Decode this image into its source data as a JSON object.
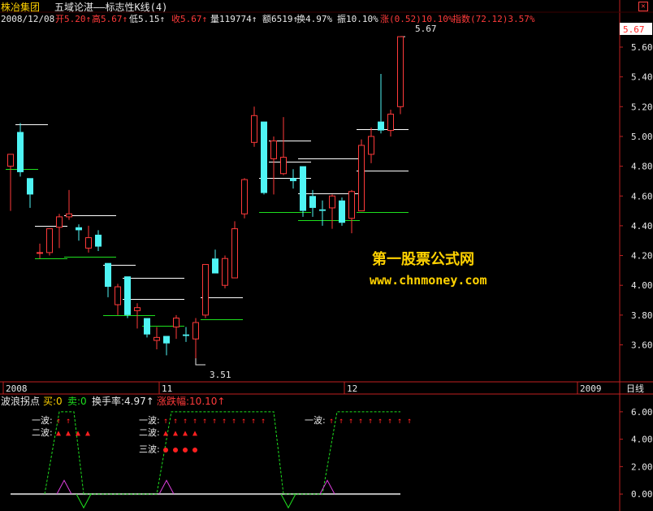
{
  "header": {
    "stock_name": "株冶集团",
    "indicator_title": "五域论湛——标志性K线(4)",
    "date": "2008/12/08",
    "open": "开5.20↑",
    "high": "高5.67↑",
    "low": "低5.15↑",
    "close": "收5.67↑",
    "volume": "量119774↑",
    "amount": "额6519↑",
    "turnover": "换4.97%",
    "amplitude": "振10.10%",
    "change": "涨(0.52)10.10%",
    "index": "指数(72.12)3.57%",
    "close_icon": "close-icon"
  },
  "price_panel": {
    "y_ticks": [
      "5.60",
      "5.40",
      "5.20",
      "5.00",
      "4.80",
      "4.60",
      "4.40",
      "4.20",
      "4.00",
      "3.80",
      "3.60"
    ],
    "current_price_box": "5.67",
    "high_label": "5.67",
    "low_label": "3.51"
  },
  "time_axis": {
    "labels": [
      "2008",
      "11",
      "12",
      "2009"
    ],
    "period_label": "日线"
  },
  "watermark": {
    "title": "第一股票公式网",
    "url": "www.chnmoney.com"
  },
  "indicator_panel": {
    "name": "波浪拐点",
    "buy": "买:0",
    "sell": "卖:0",
    "turnover": "换手率:4.97↑",
    "change": "涨跌幅:10.10↑",
    "y_ticks": [
      "6.00",
      "4.00",
      "2.00",
      "0.00"
    ],
    "wave_labels": [
      "一波:",
      "二波:",
      "一波:",
      "二波:",
      "三波:",
      "一波:"
    ]
  },
  "chart_data": {
    "type": "candlestick",
    "ylim": [
      3.45,
      5.72
    ],
    "colors": {
      "up": "#ff3a3a",
      "down": "#4ff4f4",
      "background": "#000000",
      "axis": "#c02020"
    },
    "candles": [
      {
        "o": 4.8,
        "h": 4.88,
        "l": 4.5,
        "c": 4.88
      },
      {
        "o": 5.03,
        "h": 5.09,
        "l": 4.73,
        "c": 4.76
      },
      {
        "o": 4.72,
        "h": 4.72,
        "l": 4.52,
        "c": 4.61
      },
      {
        "o": 4.22,
        "h": 4.28,
        "l": 4.18,
        "c": 4.22
      },
      {
        "o": 4.22,
        "h": 4.38,
        "l": 4.2,
        "c": 4.38
      },
      {
        "o": 4.39,
        "h": 4.48,
        "l": 4.25,
        "c": 4.46
      },
      {
        "o": 4.46,
        "h": 4.64,
        "l": 4.44,
        "c": 4.48
      },
      {
        "o": 4.39,
        "h": 4.41,
        "l": 4.3,
        "c": 4.37
      },
      {
        "o": 4.25,
        "h": 4.4,
        "l": 4.22,
        "c": 4.32
      },
      {
        "o": 4.34,
        "h": 4.37,
        "l": 4.23,
        "c": 4.26
      },
      {
        "o": 4.15,
        "h": 4.15,
        "l": 3.92,
        "c": 3.99
      },
      {
        "o": 3.87,
        "h": 4.01,
        "l": 3.8,
        "c": 3.99
      },
      {
        "o": 4.06,
        "h": 4.06,
        "l": 3.78,
        "c": 3.8
      },
      {
        "o": 3.83,
        "h": 3.88,
        "l": 3.71,
        "c": 3.85
      },
      {
        "o": 3.78,
        "h": 3.78,
        "l": 3.65,
        "c": 3.67
      },
      {
        "o": 3.63,
        "h": 3.72,
        "l": 3.57,
        "c": 3.65
      },
      {
        "o": 3.66,
        "h": 3.66,
        "l": 3.53,
        "c": 3.61
      },
      {
        "o": 3.72,
        "h": 3.8,
        "l": 3.64,
        "c": 3.78
      },
      {
        "o": 3.67,
        "h": 3.72,
        "l": 3.62,
        "c": 3.66
      },
      {
        "o": 3.64,
        "h": 3.78,
        "l": 3.51,
        "c": 3.75
      },
      {
        "o": 3.8,
        "h": 4.12,
        "l": 3.78,
        "c": 4.14
      },
      {
        "o": 4.18,
        "h": 4.24,
        "l": 4.09,
        "c": 4.08
      },
      {
        "o": 4.0,
        "h": 4.2,
        "l": 3.98,
        "c": 4.18
      },
      {
        "o": 4.05,
        "h": 4.43,
        "l": 4.05,
        "c": 4.38
      },
      {
        "o": 4.48,
        "h": 4.72,
        "l": 4.45,
        "c": 4.71
      },
      {
        "o": 4.96,
        "h": 5.2,
        "l": 4.93,
        "c": 5.14
      },
      {
        "o": 5.1,
        "h": 5.1,
        "l": 4.61,
        "c": 4.62
      },
      {
        "o": 4.85,
        "h": 5.0,
        "l": 4.61,
        "c": 4.97
      },
      {
        "o": 4.75,
        "h": 5.13,
        "l": 4.74,
        "c": 4.86
      },
      {
        "o": 4.72,
        "h": 4.78,
        "l": 4.65,
        "c": 4.7
      },
      {
        "o": 4.8,
        "h": 4.8,
        "l": 4.46,
        "c": 4.5
      },
      {
        "o": 4.6,
        "h": 4.64,
        "l": 4.46,
        "c": 4.52
      },
      {
        "o": 4.51,
        "h": 4.57,
        "l": 4.4,
        "c": 4.5
      },
      {
        "o": 4.52,
        "h": 4.61,
        "l": 4.38,
        "c": 4.6
      },
      {
        "o": 4.57,
        "h": 4.59,
        "l": 4.4,
        "c": 4.42
      },
      {
        "o": 4.45,
        "h": 4.64,
        "l": 4.35,
        "c": 4.63
      },
      {
        "o": 4.5,
        "h": 4.98,
        "l": 4.5,
        "c": 4.94
      },
      {
        "o": 4.88,
        "h": 5.06,
        "l": 4.82,
        "c": 5.0
      },
      {
        "o": 5.1,
        "h": 5.42,
        "l": 5.02,
        "c": 5.04
      },
      {
        "o": 5.04,
        "h": 5.18,
        "l": 5.0,
        "c": 5.15
      },
      {
        "o": 5.2,
        "h": 5.67,
        "l": 5.15,
        "c": 5.67
      }
    ],
    "marker_lines": [
      {
        "y": 5.08,
        "i0": 1,
        "i1": 3.0,
        "color": "#ffffff"
      },
      {
        "y": 4.78,
        "i0": 0,
        "i1": 2.0,
        "color": "#1ee01e"
      },
      {
        "y": 4.4,
        "i0": 3,
        "i1": 5.0,
        "color": "#ffffff"
      },
      {
        "y": 4.18,
        "i0": 3,
        "i1": 5.0,
        "color": "#1ee01e"
      },
      {
        "y": 4.47,
        "i0": 6,
        "i1": 10.0,
        "color": "#ffffff"
      },
      {
        "y": 4.19,
        "i0": 6,
        "i1": 10.0,
        "color": "#1ee01e"
      },
      {
        "y": 4.14,
        "i0": 10,
        "i1": 12.0,
        "color": "#ffffff"
      },
      {
        "y": 4.05,
        "i0": 12,
        "i1": 17.0,
        "color": "#ffffff"
      },
      {
        "y": 3.91,
        "i0": 12,
        "i1": 17.0,
        "color": "#ffffff"
      },
      {
        "y": 3.8,
        "i0": 10,
        "i1": 14.0,
        "color": "#1ee01e"
      },
      {
        "y": 3.73,
        "i0": 14,
        "i1": 17.0,
        "color": "#1ee01e"
      },
      {
        "y": 3.77,
        "i0": 20,
        "i1": 23.0,
        "color": "#1ee01e"
      },
      {
        "y": 3.92,
        "i0": 20,
        "i1": 23.0,
        "color": "#ffffff"
      },
      {
        "y": 4.97,
        "i0": 27,
        "i1": 30.0,
        "color": "#ffffff"
      },
      {
        "y": 4.83,
        "i0": 27,
        "i1": 30.0,
        "color": "#ffffff"
      },
      {
        "y": 4.72,
        "i0": 26,
        "i1": 30.0,
        "color": "#ffffff"
      },
      {
        "y": 4.49,
        "i0": 26,
        "i1": 30.0,
        "color": "#1ee01e"
      },
      {
        "y": 4.85,
        "i0": 30,
        "i1": 35.0,
        "color": "#ffffff"
      },
      {
        "y": 4.62,
        "i0": 30,
        "i1": 35.0,
        "color": "#ffffff"
      },
      {
        "y": 4.44,
        "i0": 30,
        "i1": 35.0,
        "color": "#1ee01e"
      },
      {
        "y": 5.05,
        "i0": 36,
        "i1": 40.0,
        "color": "#ffffff"
      },
      {
        "y": 4.77,
        "i0": 36,
        "i1": 40.0,
        "color": "#ffffff"
      },
      {
        "y": 4.49,
        "i0": 36,
        "i1": 40.0,
        "color": "#1ee01e"
      }
    ],
    "indicator": {
      "ylim": [
        -1.0,
        7.0
      ],
      "baseline": 0.0,
      "wave_line": [
        {
          "i": 3.5,
          "v": 0
        },
        {
          "i": 5.0,
          "v": 6
        },
        {
          "i": 6.5,
          "v": 6
        },
        {
          "i": 7.5,
          "v": 0
        },
        {
          "i": 15.0,
          "v": 0
        },
        {
          "i": 16.5,
          "v": 6
        },
        {
          "i": 27.0,
          "v": 6
        },
        {
          "i": 28.0,
          "v": 0
        },
        {
          "i": 32.0,
          "v": 0
        },
        {
          "i": 33.5,
          "v": 6
        },
        {
          "i": 40.0,
          "v": 6
        }
      ],
      "peaks": [
        {
          "i": 5.5,
          "v": 1.0
        },
        {
          "i": 16.0,
          "v": 1.0
        },
        {
          "i": 32.5,
          "v": 1.0
        }
      ],
      "troughs": [
        {
          "i": 7.5,
          "v": -1.0
        },
        {
          "i": 28.5,
          "v": -1.0
        }
      ],
      "rows": [
        {
          "label_index": 0,
          "v": 5.4,
          "i0": 5,
          "count": 2,
          "symbol": "↑"
        },
        {
          "label_index": 1,
          "v": 4.5,
          "i0": 5,
          "count": 4,
          "symbol": "▲"
        },
        {
          "label_index": 2,
          "v": 5.4,
          "i0": 16,
          "count": 11,
          "symbol": "↑"
        },
        {
          "label_index": 3,
          "v": 4.5,
          "i0": 16,
          "count": 4,
          "symbol": "▲"
        },
        {
          "label_index": 4,
          "v": 3.3,
          "i0": 16,
          "count": 4,
          "symbol": "●"
        },
        {
          "label_index": 5,
          "v": 5.4,
          "i0": 33,
          "count": 9,
          "symbol": "↑"
        }
      ]
    }
  }
}
